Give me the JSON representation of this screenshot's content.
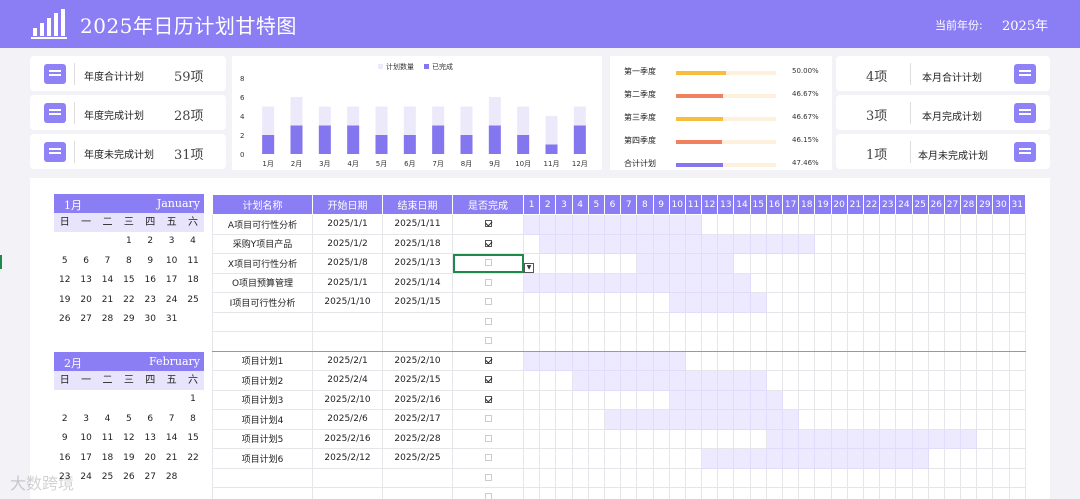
{
  "header": {
    "title": "2025年日历计划甘特图",
    "year_label": "当前年份:",
    "year_value": "2025年"
  },
  "summary_left": [
    {
      "label": "年度合计计划",
      "value": "59项"
    },
    {
      "label": "年度完成计划",
      "value": "28项"
    },
    {
      "label": "年度未完成计划",
      "value": "31项"
    }
  ],
  "summary_right": [
    {
      "label": "本月合计计划",
      "value": "4项"
    },
    {
      "label": "本月完成计划",
      "value": "3项"
    },
    {
      "label": "本月未完成计划",
      "value": "1项"
    }
  ],
  "chart_data": {
    "type": "bar",
    "legend": [
      "计划数量",
      "已完成"
    ],
    "categories": [
      "1月",
      "2月",
      "3月",
      "4月",
      "5月",
      "6月",
      "7月",
      "8月",
      "9月",
      "10月",
      "11月",
      "12月"
    ],
    "series": [
      {
        "name": "计划数量",
        "values": [
          5,
          6,
          5,
          5,
          5,
          5,
          5,
          5,
          6,
          5,
          4,
          5
        ]
      },
      {
        "name": "已完成",
        "values": [
          2,
          3,
          3,
          3,
          2,
          2,
          3,
          2,
          3,
          2,
          1,
          3
        ]
      }
    ],
    "ylim": [
      0,
      8
    ],
    "yticks": [
      "0",
      "2",
      "4",
      "6",
      "8"
    ],
    "colors": {
      "plan": "#ece9fb",
      "done": "#8376ee"
    }
  },
  "quarters": [
    {
      "label": "第一季度",
      "pct": "50.00%",
      "value": 0.5,
      "color": "#f7bd3c"
    },
    {
      "label": "第二季度",
      "pct": "46.67%",
      "value": 0.4667,
      "color": "#f0805e"
    },
    {
      "label": "第三季度",
      "pct": "46.67%",
      "value": 0.4667,
      "color": "#f7bd3c"
    },
    {
      "label": "第四季度",
      "pct": "46.15%",
      "value": 0.4615,
      "color": "#f0805e"
    },
    {
      "label": "合计计划",
      "pct": "47.46%",
      "value": 0.4746,
      "color": "#8376ee"
    }
  ],
  "weekdays": [
    "日",
    "一",
    "二",
    "三",
    "四",
    "五",
    "六"
  ],
  "calendars": [
    {
      "month": "1月",
      "english": "January",
      "days": [
        "",
        "",
        "",
        1,
        2,
        3,
        4,
        5,
        6,
        7,
        8,
        9,
        10,
        11,
        12,
        13,
        14,
        15,
        16,
        17,
        18,
        19,
        20,
        21,
        22,
        23,
        24,
        25,
        26,
        27,
        28,
        29,
        30,
        31
      ]
    },
    {
      "month": "2月",
      "english": "February",
      "days": [
        "",
        "",
        "",
        "",
        "",
        "",
        1,
        2,
        3,
        4,
        5,
        6,
        7,
        8,
        9,
        10,
        11,
        12,
        13,
        14,
        15,
        16,
        17,
        18,
        19,
        20,
        21,
        22,
        23,
        24,
        25,
        26,
        27,
        28
      ]
    }
  ],
  "plan_table": {
    "headers": [
      "计划名称",
      "开始日期",
      "结束日期",
      "是否完成"
    ],
    "day_headers": [
      "1",
      "2",
      "3",
      "4",
      "5",
      "6",
      "7",
      "8",
      "9",
      "10",
      "11",
      "12",
      "13",
      "14",
      "15",
      "16",
      "17",
      "18",
      "19",
      "20",
      "21",
      "22",
      "23",
      "24",
      "25",
      "26",
      "27",
      "28",
      "29",
      "30",
      "31"
    ],
    "rows": [
      {
        "name": "A项目可行性分析",
        "start": "2025/1/1",
        "end": "2025/1/11",
        "done": true,
        "s": 1,
        "e": 11
      },
      {
        "name": "采购Y项目产品",
        "start": "2025/1/2",
        "end": "2025/1/18",
        "done": true,
        "s": 2,
        "e": 18
      },
      {
        "name": "X项目可行性分析",
        "start": "2025/1/8",
        "end": "2025/1/13",
        "done": false,
        "s": 8,
        "e": 13
      },
      {
        "name": "O项目预算管理",
        "start": "2025/1/1",
        "end": "2025/1/14",
        "done": false,
        "s": 1,
        "e": 14
      },
      {
        "name": "I项目可行性分析",
        "start": "2025/1/10",
        "end": "2025/1/15",
        "done": false,
        "s": 10,
        "e": 15
      },
      {
        "name": "",
        "start": "",
        "end": "",
        "done": false,
        "s": 0,
        "e": 0
      },
      {
        "name": "",
        "start": "",
        "end": "",
        "done": false,
        "s": 0,
        "e": 0
      },
      {
        "name": "项目计划1",
        "start": "2025/2/1",
        "end": "2025/2/10",
        "done": true,
        "s": 1,
        "e": 10
      },
      {
        "name": "项目计划2",
        "start": "2025/2/4",
        "end": "2025/2/15",
        "done": true,
        "s": 4,
        "e": 15
      },
      {
        "name": "项目计划3",
        "start": "2025/2/10",
        "end": "2025/2/16",
        "done": true,
        "s": 10,
        "e": 16
      },
      {
        "name": "项目计划4",
        "start": "2025/2/6",
        "end": "2025/2/17",
        "done": false,
        "s": 6,
        "e": 17
      },
      {
        "name": "项目计划5",
        "start": "2025/2/16",
        "end": "2025/2/28",
        "done": false,
        "s": 16,
        "e": 28
      },
      {
        "name": "项目计划6",
        "start": "2025/2/12",
        "end": "2025/2/25",
        "done": false,
        "s": 12,
        "e": 25
      },
      {
        "name": "",
        "start": "",
        "end": "",
        "done": false,
        "s": 0,
        "e": 0
      },
      {
        "name": "",
        "start": "",
        "end": "",
        "done": false,
        "s": 0,
        "e": 0
      }
    ]
  },
  "watermark": "大数跨境"
}
